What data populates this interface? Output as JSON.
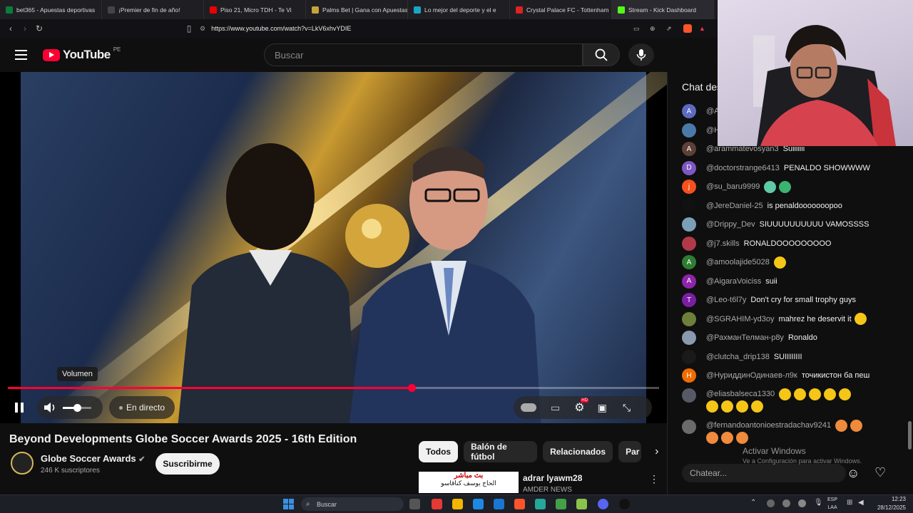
{
  "browser": {
    "tabs": [
      {
        "label": "bet365 - Apuestas deportivas",
        "color": "#0a7d3b"
      },
      {
        "label": "¡Premier de fin de año!",
        "color": "#444"
      },
      {
        "label": "Piso 21, Micro TDH - Te Vi",
        "color": "#e00"
      },
      {
        "label": "Palms Bet | Gana con Apuestas",
        "color": "#c8a23c"
      },
      {
        "label": "Lo mejor del deporte y el e",
        "color": "#1aa5c8"
      },
      {
        "label": "Crystal Palace FC - Tottenham",
        "color": "#d22"
      },
      {
        "label": "Stream - Kick Dashboard",
        "color": "#53fc18"
      }
    ],
    "url": "https://www.youtube.com/watch?v=LkV6xhvYDIE"
  },
  "youtube": {
    "logo_text": "YouTube",
    "country": "PE",
    "search_placeholder": "Buscar"
  },
  "player": {
    "volume_tooltip": "Volumen",
    "live_label": "En directo",
    "progress_fraction": 0.62,
    "volume_fraction": 0.5,
    "hd_badge": "HD"
  },
  "video": {
    "title": "Beyond Developments Globe Soccer Awards 2025 - 16th Edition",
    "channel": "Globe Soccer Awards",
    "subscribers": "246 K suscriptores",
    "subscribe_label": "Suscribirme"
  },
  "chips": [
    "Todos",
    "Balón de fútbol",
    "Relacionados",
    "Par"
  ],
  "recommended": {
    "title": "adrar lyawm28",
    "channel": "AMDER NEWS",
    "thumb_text_1": "بث مباشر",
    "thumb_text_2": "الحاج يوسف كناقاسو"
  },
  "chat": {
    "title": "Chat des",
    "input_placeholder": "Chatear...",
    "messages": [
      {
        "initial": "A",
        "color": "#5c6bc0",
        "author": "@A",
        "text": ""
      },
      {
        "initial": "",
        "color": "#4a7aa8",
        "author": "@H",
        "text": ""
      },
      {
        "initial": "A",
        "color": "#5d4037",
        "author": "@arammatevosyan3",
        "text": "Suiiiiiii"
      },
      {
        "initial": "D",
        "color": "#7e57c2",
        "author": "@doctorstrange6413",
        "text": "PENALDO SHOWWWW"
      },
      {
        "initial": "j",
        "color": "#f4511e",
        "author": "@su_baru9999",
        "text": ""
      },
      {
        "initial": "",
        "color": "#111111",
        "author": "@JereDaniel-25",
        "text": "is penaldooooooopoo"
      },
      {
        "initial": "",
        "color": "#7aa0b8",
        "author": "@Drippy_Dev",
        "text": "SIUUUUUUUUUU VAMOSSSS"
      },
      {
        "initial": "",
        "color": "#b23a48",
        "author": "@j7.skills",
        "text": "RONALDOOOOOOOOO"
      },
      {
        "initial": "A",
        "color": "#2e7d32",
        "author": "@amoolajide5028",
        "text": ""
      },
      {
        "initial": "A",
        "color": "#8e24aa",
        "author": "@AigaraVoiciss",
        "text": "suii"
      },
      {
        "initial": "T",
        "color": "#7b1fa2",
        "author": "@Leo-t6l7y",
        "text": "Don't cry for small trophy guys"
      },
      {
        "initial": "",
        "color": "#6d7f3a",
        "author": "@SGRAHIM-yd3oy",
        "text": "mahrez he deservit it"
      },
      {
        "initial": "",
        "color": "#8a99ad",
        "author": "@РахманТелман-р8у",
        "text": "Ronaldo"
      },
      {
        "initial": "",
        "color": "#1a1a1a",
        "author": "@clutcha_drip138",
        "text": "SUIIIIIIII"
      },
      {
        "initial": "H",
        "color": "#ef6c00",
        "author": "@НуриддинОдинаев-л9к",
        "text": "точикистон ба пеш"
      },
      {
        "initial": "",
        "color": "#555a66",
        "author": "@eliasbalseca1330",
        "text": ""
      },
      {
        "initial": "",
        "color": "#6b6b6b",
        "author": "@fernandoantonioestradachav9241",
        "text": ""
      }
    ]
  },
  "windows_watermark": {
    "line1": "Activar Windows",
    "line2": "Ve a Configuración para activar Windows."
  },
  "taskbar": {
    "search_label": "Buscar",
    "lang": "ESP",
    "region": "LAA",
    "time": "12:23",
    "date": "28/12/2025"
  }
}
